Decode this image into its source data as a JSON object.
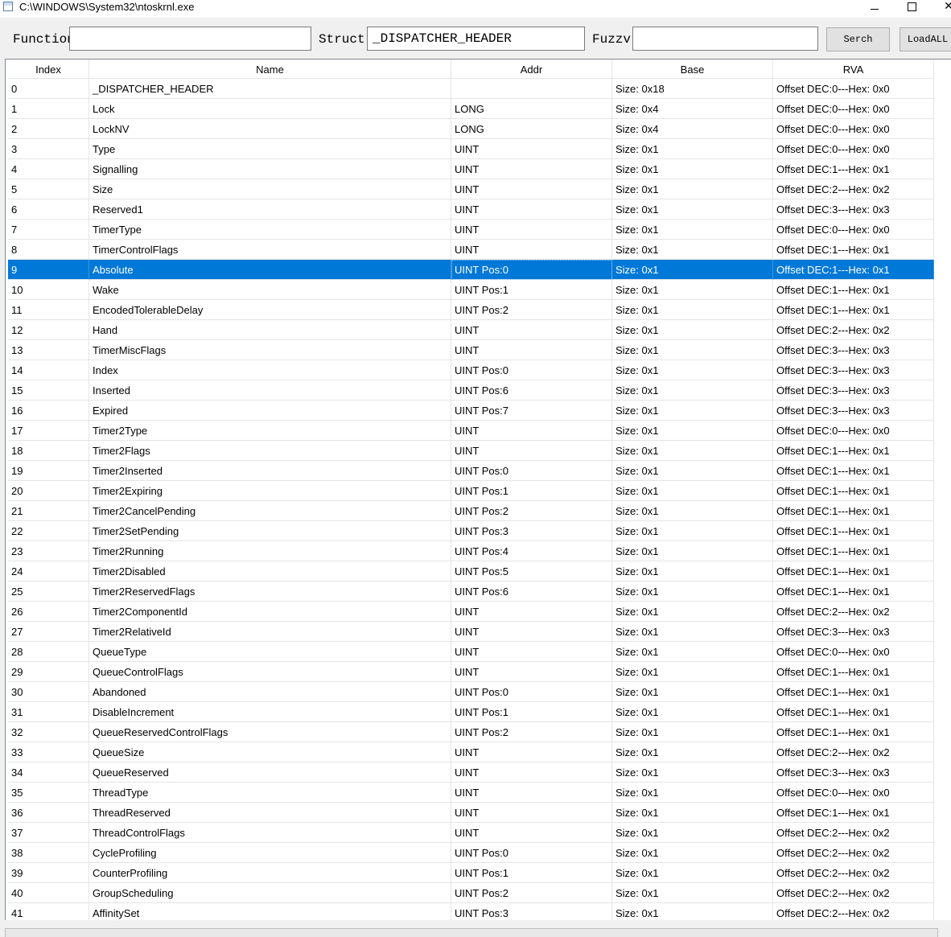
{
  "window": {
    "title": "C:\\WINDOWS\\System32\\ntoskrnl.exe",
    "icon": "app-window-icon",
    "controls": {
      "minimize": "minimize-icon",
      "maximize": "maximize-icon",
      "close": "✕"
    }
  },
  "toolbar": {
    "function_label": "Function",
    "function_value": "",
    "struct_label": "Struct",
    "struct_value": "_DISPATCHER_HEADER",
    "fuzzy_label": "Fuzzv",
    "fuzzy_value": "",
    "search_label": "Serch",
    "loadall_label": "LoadALL"
  },
  "table": {
    "columns": [
      "Index",
      "Name",
      "Addr",
      "Base",
      "RVA"
    ],
    "selected_index": 9,
    "selection_color": "#0078d7",
    "rows": [
      [
        "0",
        "_DISPATCHER_HEADER",
        "",
        "Size: 0x18",
        "Offset DEC:0---Hex: 0x0"
      ],
      [
        "1",
        "Lock",
        "LONG",
        "Size: 0x4",
        "Offset DEC:0---Hex: 0x0"
      ],
      [
        "2",
        "LockNV",
        "LONG",
        "Size: 0x4",
        "Offset DEC:0---Hex: 0x0"
      ],
      [
        "3",
        "Type",
        "UINT",
        "Size: 0x1",
        "Offset DEC:0---Hex: 0x0"
      ],
      [
        "4",
        "Signalling",
        "UINT",
        "Size: 0x1",
        "Offset DEC:1---Hex: 0x1"
      ],
      [
        "5",
        "Size",
        "UINT",
        "Size: 0x1",
        "Offset DEC:2---Hex: 0x2"
      ],
      [
        "6",
        "Reserved1",
        "UINT",
        "Size: 0x1",
        "Offset DEC:3---Hex: 0x3"
      ],
      [
        "7",
        "TimerType",
        "UINT",
        "Size: 0x1",
        "Offset DEC:0---Hex: 0x0"
      ],
      [
        "8",
        "TimerControlFlags",
        "UINT",
        "Size: 0x1",
        "Offset DEC:1---Hex: 0x1"
      ],
      [
        "9",
        "Absolute",
        "UINT Pos:0",
        "Size: 0x1",
        "Offset DEC:1---Hex: 0x1"
      ],
      [
        "10",
        "Wake",
        "UINT Pos:1",
        "Size: 0x1",
        "Offset DEC:1---Hex: 0x1"
      ],
      [
        "11",
        "EncodedTolerableDelay",
        "UINT Pos:2",
        "Size: 0x1",
        "Offset DEC:1---Hex: 0x1"
      ],
      [
        "12",
        "Hand",
        "UINT",
        "Size: 0x1",
        "Offset DEC:2---Hex: 0x2"
      ],
      [
        "13",
        "TimerMiscFlags",
        "UINT",
        "Size: 0x1",
        "Offset DEC:3---Hex: 0x3"
      ],
      [
        "14",
        "Index",
        "UINT Pos:0",
        "Size: 0x1",
        "Offset DEC:3---Hex: 0x3"
      ],
      [
        "15",
        "Inserted",
        "UINT Pos:6",
        "Size: 0x1",
        "Offset DEC:3---Hex: 0x3"
      ],
      [
        "16",
        "Expired",
        "UINT Pos:7",
        "Size: 0x1",
        "Offset DEC:3---Hex: 0x3"
      ],
      [
        "17",
        "Timer2Type",
        "UINT",
        "Size: 0x1",
        "Offset DEC:0---Hex: 0x0"
      ],
      [
        "18",
        "Timer2Flags",
        "UINT",
        "Size: 0x1",
        "Offset DEC:1---Hex: 0x1"
      ],
      [
        "19",
        "Timer2Inserted",
        "UINT Pos:0",
        "Size: 0x1",
        "Offset DEC:1---Hex: 0x1"
      ],
      [
        "20",
        "Timer2Expiring",
        "UINT Pos:1",
        "Size: 0x1",
        "Offset DEC:1---Hex: 0x1"
      ],
      [
        "21",
        "Timer2CancelPending",
        "UINT Pos:2",
        "Size: 0x1",
        "Offset DEC:1---Hex: 0x1"
      ],
      [
        "22",
        "Timer2SetPending",
        "UINT Pos:3",
        "Size: 0x1",
        "Offset DEC:1---Hex: 0x1"
      ],
      [
        "23",
        "Timer2Running",
        "UINT Pos:4",
        "Size: 0x1",
        "Offset DEC:1---Hex: 0x1"
      ],
      [
        "24",
        "Timer2Disabled",
        "UINT Pos:5",
        "Size: 0x1",
        "Offset DEC:1---Hex: 0x1"
      ],
      [
        "25",
        "Timer2ReservedFlags",
        "UINT Pos:6",
        "Size: 0x1",
        "Offset DEC:1---Hex: 0x1"
      ],
      [
        "26",
        "Timer2ComponentId",
        "UINT",
        "Size: 0x1",
        "Offset DEC:2---Hex: 0x2"
      ],
      [
        "27",
        "Timer2RelativeId",
        "UINT",
        "Size: 0x1",
        "Offset DEC:3---Hex: 0x3"
      ],
      [
        "28",
        "QueueType",
        "UINT",
        "Size: 0x1",
        "Offset DEC:0---Hex: 0x0"
      ],
      [
        "29",
        "QueueControlFlags",
        "UINT",
        "Size: 0x1",
        "Offset DEC:1---Hex: 0x1"
      ],
      [
        "30",
        "Abandoned",
        "UINT Pos:0",
        "Size: 0x1",
        "Offset DEC:1---Hex: 0x1"
      ],
      [
        "31",
        "DisableIncrement",
        "UINT Pos:1",
        "Size: 0x1",
        "Offset DEC:1---Hex: 0x1"
      ],
      [
        "32",
        "QueueReservedControlFlags",
        "UINT Pos:2",
        "Size: 0x1",
        "Offset DEC:1---Hex: 0x1"
      ],
      [
        "33",
        "QueueSize",
        "UINT",
        "Size: 0x1",
        "Offset DEC:2---Hex: 0x2"
      ],
      [
        "34",
        "QueueReserved",
        "UINT",
        "Size: 0x1",
        "Offset DEC:3---Hex: 0x3"
      ],
      [
        "35",
        "ThreadType",
        "UINT",
        "Size: 0x1",
        "Offset DEC:0---Hex: 0x0"
      ],
      [
        "36",
        "ThreadReserved",
        "UINT",
        "Size: 0x1",
        "Offset DEC:1---Hex: 0x1"
      ],
      [
        "37",
        "ThreadControlFlags",
        "UINT",
        "Size: 0x1",
        "Offset DEC:2---Hex: 0x2"
      ],
      [
        "38",
        "CycleProfiling",
        "UINT Pos:0",
        "Size: 0x1",
        "Offset DEC:2---Hex: 0x2"
      ],
      [
        "39",
        "CounterProfiling",
        "UINT Pos:1",
        "Size: 0x1",
        "Offset DEC:2---Hex: 0x2"
      ],
      [
        "40",
        "GroupScheduling",
        "UINT Pos:2",
        "Size: 0x1",
        "Offset DEC:2---Hex: 0x2"
      ],
      [
        "41",
        "AffinitySet",
        "UINT Pos:3",
        "Size: 0x1",
        "Offset DEC:2---Hex: 0x2"
      ]
    ]
  }
}
